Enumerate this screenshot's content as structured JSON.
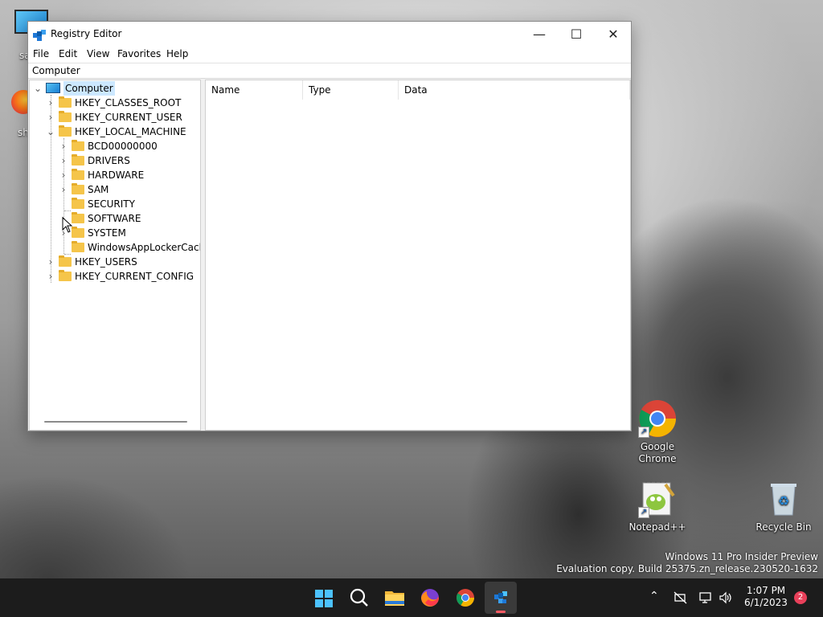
{
  "window": {
    "title": "Registry Editor",
    "controls": {
      "minimize": "—",
      "maximize": "☐",
      "close": "✕"
    }
  },
  "menu": [
    "File",
    "Edit",
    "View",
    "Favorites",
    "Help"
  ],
  "address": "Computer",
  "tree": {
    "root": "Computer",
    "hives": [
      "HKEY_CLASSES_ROOT",
      "HKEY_CURRENT_USER",
      "HKEY_LOCAL_MACHINE",
      "HKEY_USERS",
      "HKEY_CURRENT_CONFIG"
    ],
    "hklm_children": [
      "BCD00000000",
      "DRIVERS",
      "HARDWARE",
      "SAM",
      "SECURITY",
      "SOFTWARE",
      "SYSTEM",
      "WindowsAppLockerCache"
    ]
  },
  "list": {
    "columns": [
      "Name",
      "Type",
      "Data"
    ]
  },
  "desktop": {
    "icons": [
      {
        "label": "Google Chrome"
      },
      {
        "label": "Notepad++"
      },
      {
        "label": "Recycle Bin"
      }
    ],
    "partial_labels": [
      "sa",
      "sh"
    ],
    "watermark": {
      "line1": "Windows 11 Pro Insider Preview",
      "line2": "Evaluation copy. Build 25375.zn_release.230520-1632"
    }
  },
  "taskbar": {
    "time": "1:07 PM",
    "date": "6/1/2023",
    "notification_count": "2",
    "icons": [
      "start-icon",
      "search-icon",
      "file-explorer-icon",
      "firefox-icon",
      "chrome-icon",
      "registry-editor-icon"
    ]
  },
  "colors": {
    "accent": "#0078d4",
    "selection": "#cce8ff",
    "taskbar": "#1c1c1c",
    "folder": "#f5c54a",
    "badge": "#e8405a"
  }
}
